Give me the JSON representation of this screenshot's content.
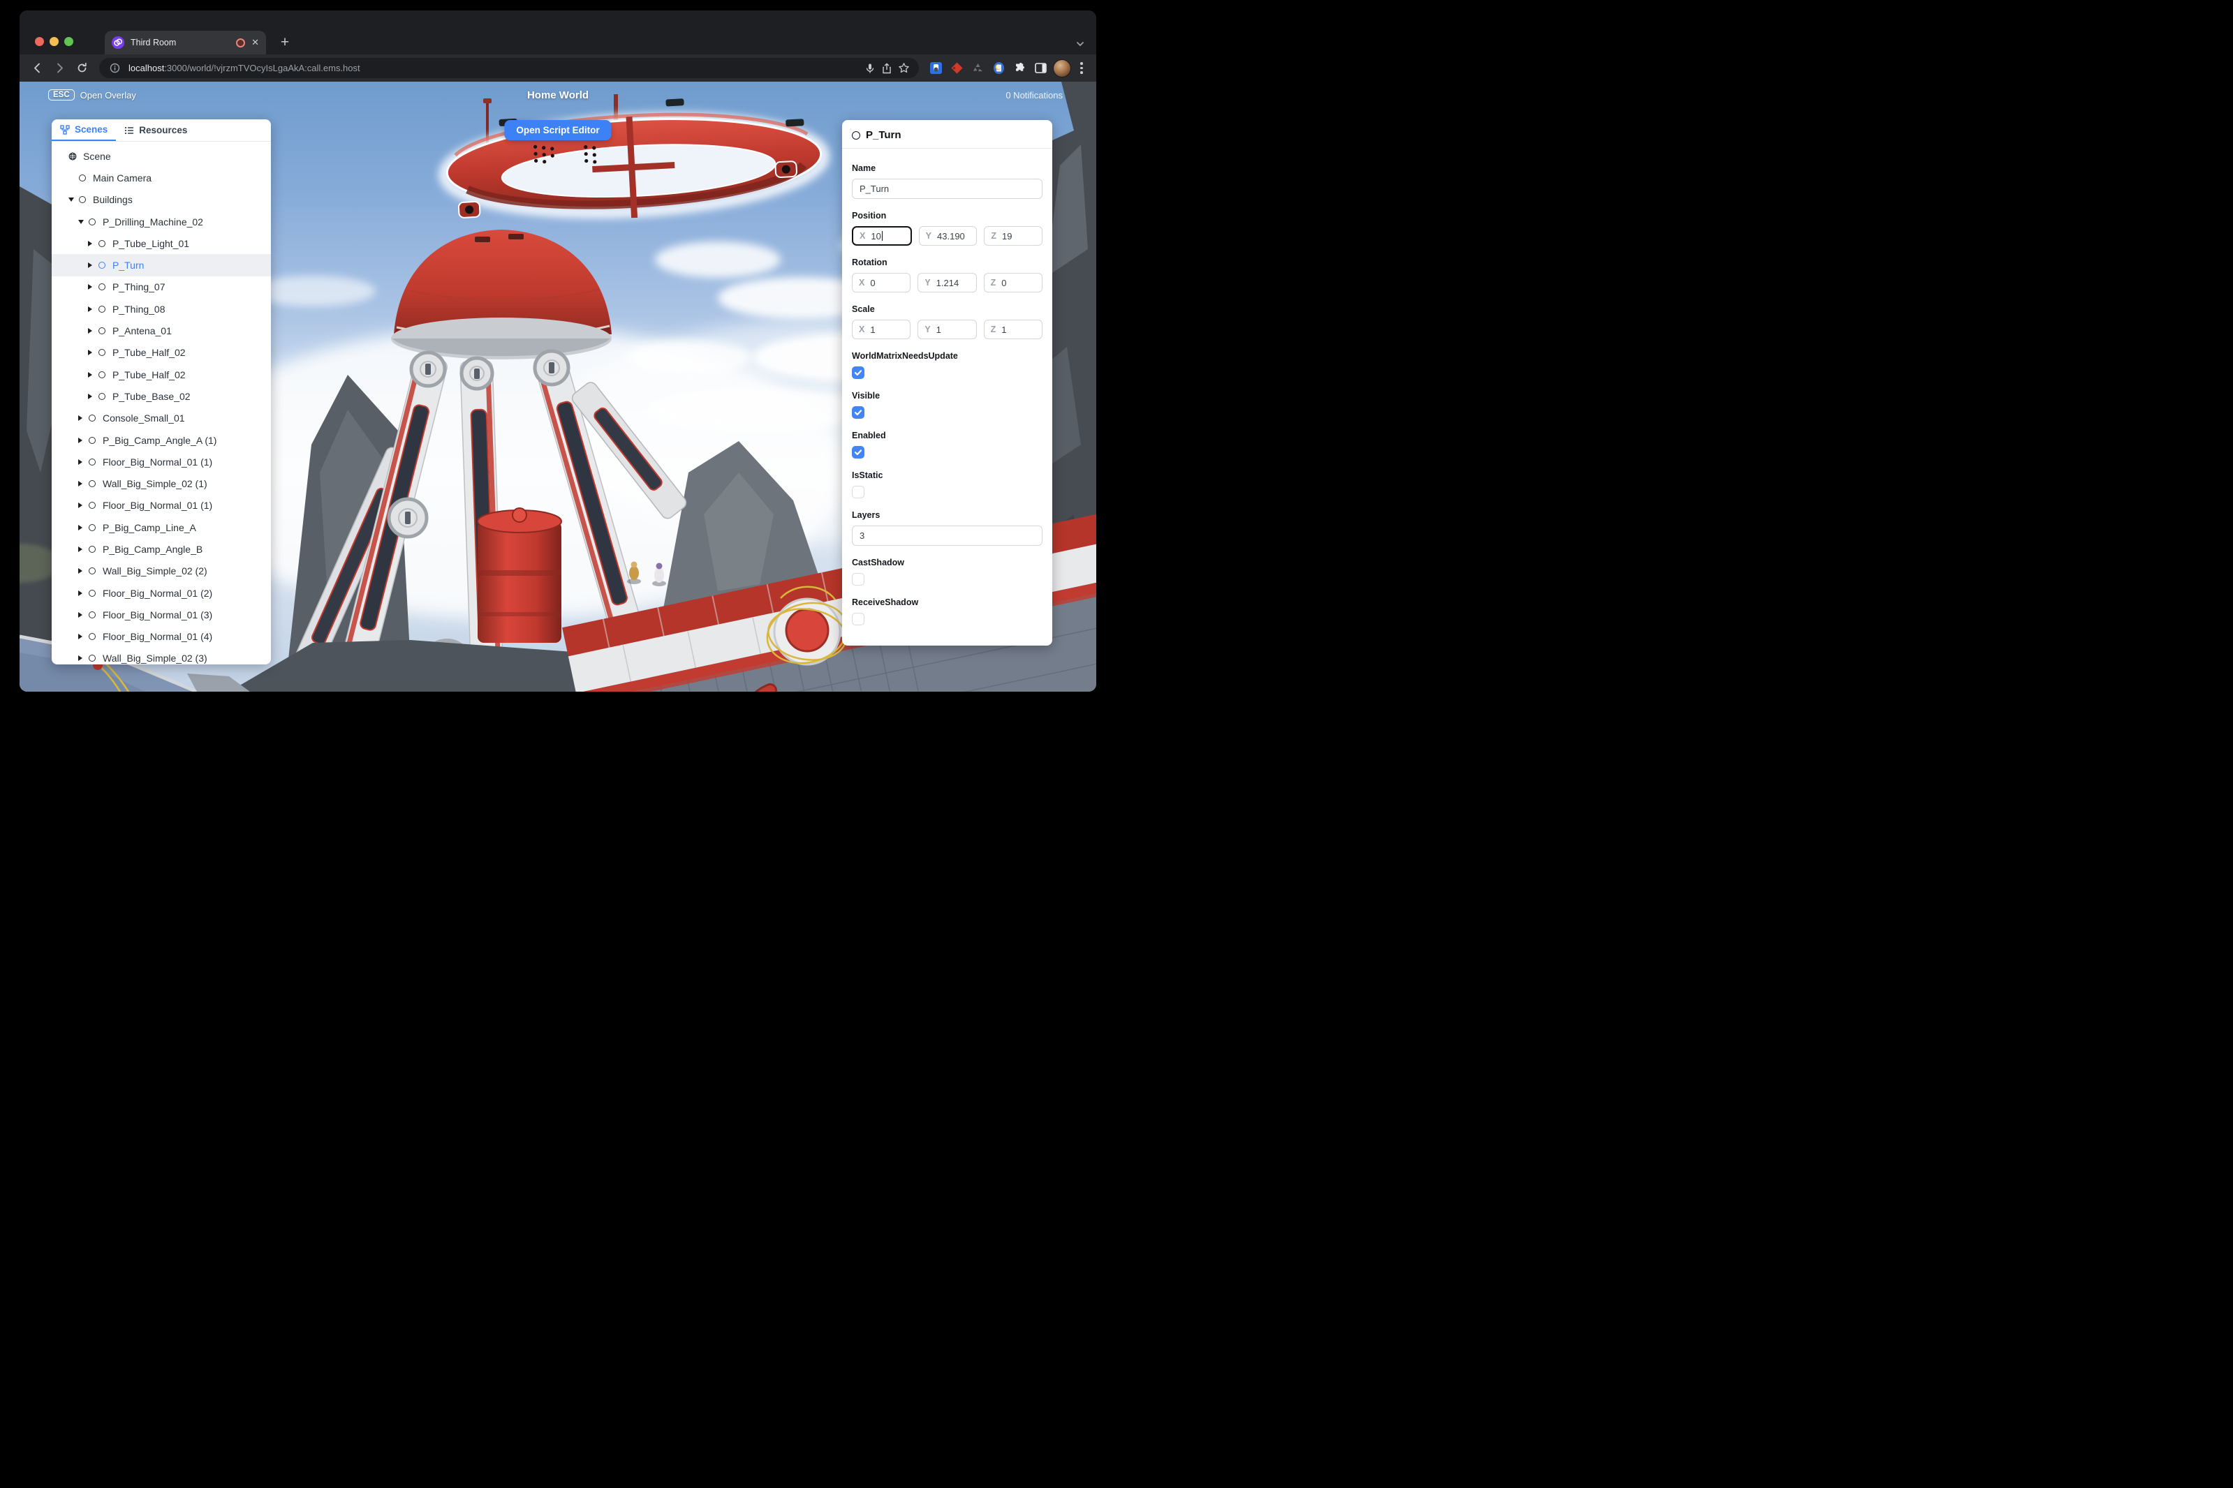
{
  "browser": {
    "window_controls": [
      "close",
      "minimize",
      "zoom"
    ],
    "tab": {
      "title": "Third Room",
      "recording": true,
      "close_label": "✕"
    },
    "new_tab_label": "+",
    "nav": {
      "back": "back-arrow",
      "forward": "forward-arrow",
      "reload": "reload"
    },
    "url": {
      "host": "localhost",
      "rest": ":3000/world/!vjrzmTVOcyIsLgaAkA:call.ems.host"
    },
    "omnibox_icons": [
      "info",
      "mic",
      "share",
      "bookmark-star"
    ],
    "extension_icons": [
      "password-manager",
      "devtools-red-diamond",
      "recycle",
      "reader-mode",
      "extensions-puzzle",
      "side-panel"
    ],
    "profile": "avatar",
    "menu": "kebab-menu"
  },
  "overlay": {
    "esc_key": "ESC",
    "esc_label": "Open Overlay",
    "world_title": "Home World",
    "notifications": "0 Notifications",
    "open_script_editor": "Open Script Editor"
  },
  "sidebar": {
    "tabs": [
      {
        "label": "Scenes",
        "active": true,
        "icon": "hierarchy-icon"
      },
      {
        "label": "Resources",
        "active": false,
        "icon": "list-icon"
      }
    ],
    "tree": [
      {
        "label": "Scene",
        "depth": 0,
        "icon": "globe",
        "arrow": "none",
        "selected": false
      },
      {
        "label": "Main Camera",
        "depth": 1,
        "icon": "circle",
        "arrow": "none",
        "selected": false
      },
      {
        "label": "Buildings",
        "depth": 1,
        "icon": "circle",
        "arrow": "down",
        "selected": false
      },
      {
        "label": "P_Drilling_Machine_02",
        "depth": 2,
        "icon": "circle",
        "arrow": "down",
        "selected": false
      },
      {
        "label": "P_Tube_Light_01",
        "depth": 3,
        "icon": "circle",
        "arrow": "right",
        "selected": false
      },
      {
        "label": "P_Turn",
        "depth": 3,
        "icon": "circle",
        "arrow": "right",
        "selected": true
      },
      {
        "label": "P_Thing_07",
        "depth": 3,
        "icon": "circle",
        "arrow": "right",
        "selected": false
      },
      {
        "label": "P_Thing_08",
        "depth": 3,
        "icon": "circle",
        "arrow": "right",
        "selected": false
      },
      {
        "label": "P_Antena_01",
        "depth": 3,
        "icon": "circle",
        "arrow": "right",
        "selected": false
      },
      {
        "label": "P_Tube_Half_02",
        "depth": 3,
        "icon": "circle",
        "arrow": "right",
        "selected": false
      },
      {
        "label": "P_Tube_Half_02",
        "depth": 3,
        "icon": "circle",
        "arrow": "right",
        "selected": false
      },
      {
        "label": "P_Tube_Base_02",
        "depth": 3,
        "icon": "circle",
        "arrow": "right",
        "selected": false
      },
      {
        "label": "Console_Small_01",
        "depth": 2,
        "icon": "circle",
        "arrow": "right",
        "selected": false
      },
      {
        "label": "P_Big_Camp_Angle_A (1)",
        "depth": 2,
        "icon": "circle",
        "arrow": "right",
        "selected": false
      },
      {
        "label": "Floor_Big_Normal_01 (1)",
        "depth": 2,
        "icon": "circle",
        "arrow": "right",
        "selected": false
      },
      {
        "label": "Wall_Big_Simple_02 (1)",
        "depth": 2,
        "icon": "circle",
        "arrow": "right",
        "selected": false
      },
      {
        "label": "Floor_Big_Normal_01 (1)",
        "depth": 2,
        "icon": "circle",
        "arrow": "right",
        "selected": false
      },
      {
        "label": "P_Big_Camp_Line_A",
        "depth": 2,
        "icon": "circle",
        "arrow": "right",
        "selected": false
      },
      {
        "label": "P_Big_Camp_Angle_B",
        "depth": 2,
        "icon": "circle",
        "arrow": "right",
        "selected": false
      },
      {
        "label": "Wall_Big_Simple_02 (2)",
        "depth": 2,
        "icon": "circle",
        "arrow": "right",
        "selected": false
      },
      {
        "label": "Floor_Big_Normal_01 (2)",
        "depth": 2,
        "icon": "circle",
        "arrow": "right",
        "selected": false
      },
      {
        "label": "Floor_Big_Normal_01 (3)",
        "depth": 2,
        "icon": "circle",
        "arrow": "right",
        "selected": false
      },
      {
        "label": "Floor_Big_Normal_01 (4)",
        "depth": 2,
        "icon": "circle",
        "arrow": "right",
        "selected": false
      },
      {
        "label": "Wall_Big_Simple_02 (3)",
        "depth": 2,
        "icon": "circle",
        "arrow": "right",
        "selected": false
      }
    ]
  },
  "inspector": {
    "title": "P_Turn",
    "fields": [
      {
        "type": "text",
        "label": "Name",
        "value": "P_Turn"
      },
      {
        "type": "vector",
        "label": "Position",
        "x": "10",
        "y": "43.190",
        "z": "19",
        "focused": "x"
      },
      {
        "type": "vector",
        "label": "Rotation",
        "x": "0",
        "y": "1.214",
        "z": "0",
        "focused": ""
      },
      {
        "type": "vector",
        "label": "Scale",
        "x": "1",
        "y": "1",
        "z": "1",
        "focused": ""
      },
      {
        "type": "checkbox",
        "label": "WorldMatrixNeedsUpdate",
        "checked": true
      },
      {
        "type": "checkbox",
        "label": "Visible",
        "checked": true
      },
      {
        "type": "checkbox",
        "label": "Enabled",
        "checked": true
      },
      {
        "type": "checkbox",
        "label": "IsStatic",
        "checked": false
      },
      {
        "type": "text",
        "label": "Layers",
        "value": "3"
      },
      {
        "type": "checkbox",
        "label": "CastShadow",
        "checked": false
      },
      {
        "type": "checkbox",
        "label": "ReceiveShadow",
        "checked": false
      }
    ]
  },
  "colors": {
    "accent_blue": "#3b82f6",
    "button_blue": "#3d82f4",
    "checkbox_blue": "#4285f4",
    "machine_red": "#c0392e",
    "selection_outline": "#ffffff",
    "chrome_dark": "#1e1f22",
    "panel_bg": "#ffffff"
  }
}
